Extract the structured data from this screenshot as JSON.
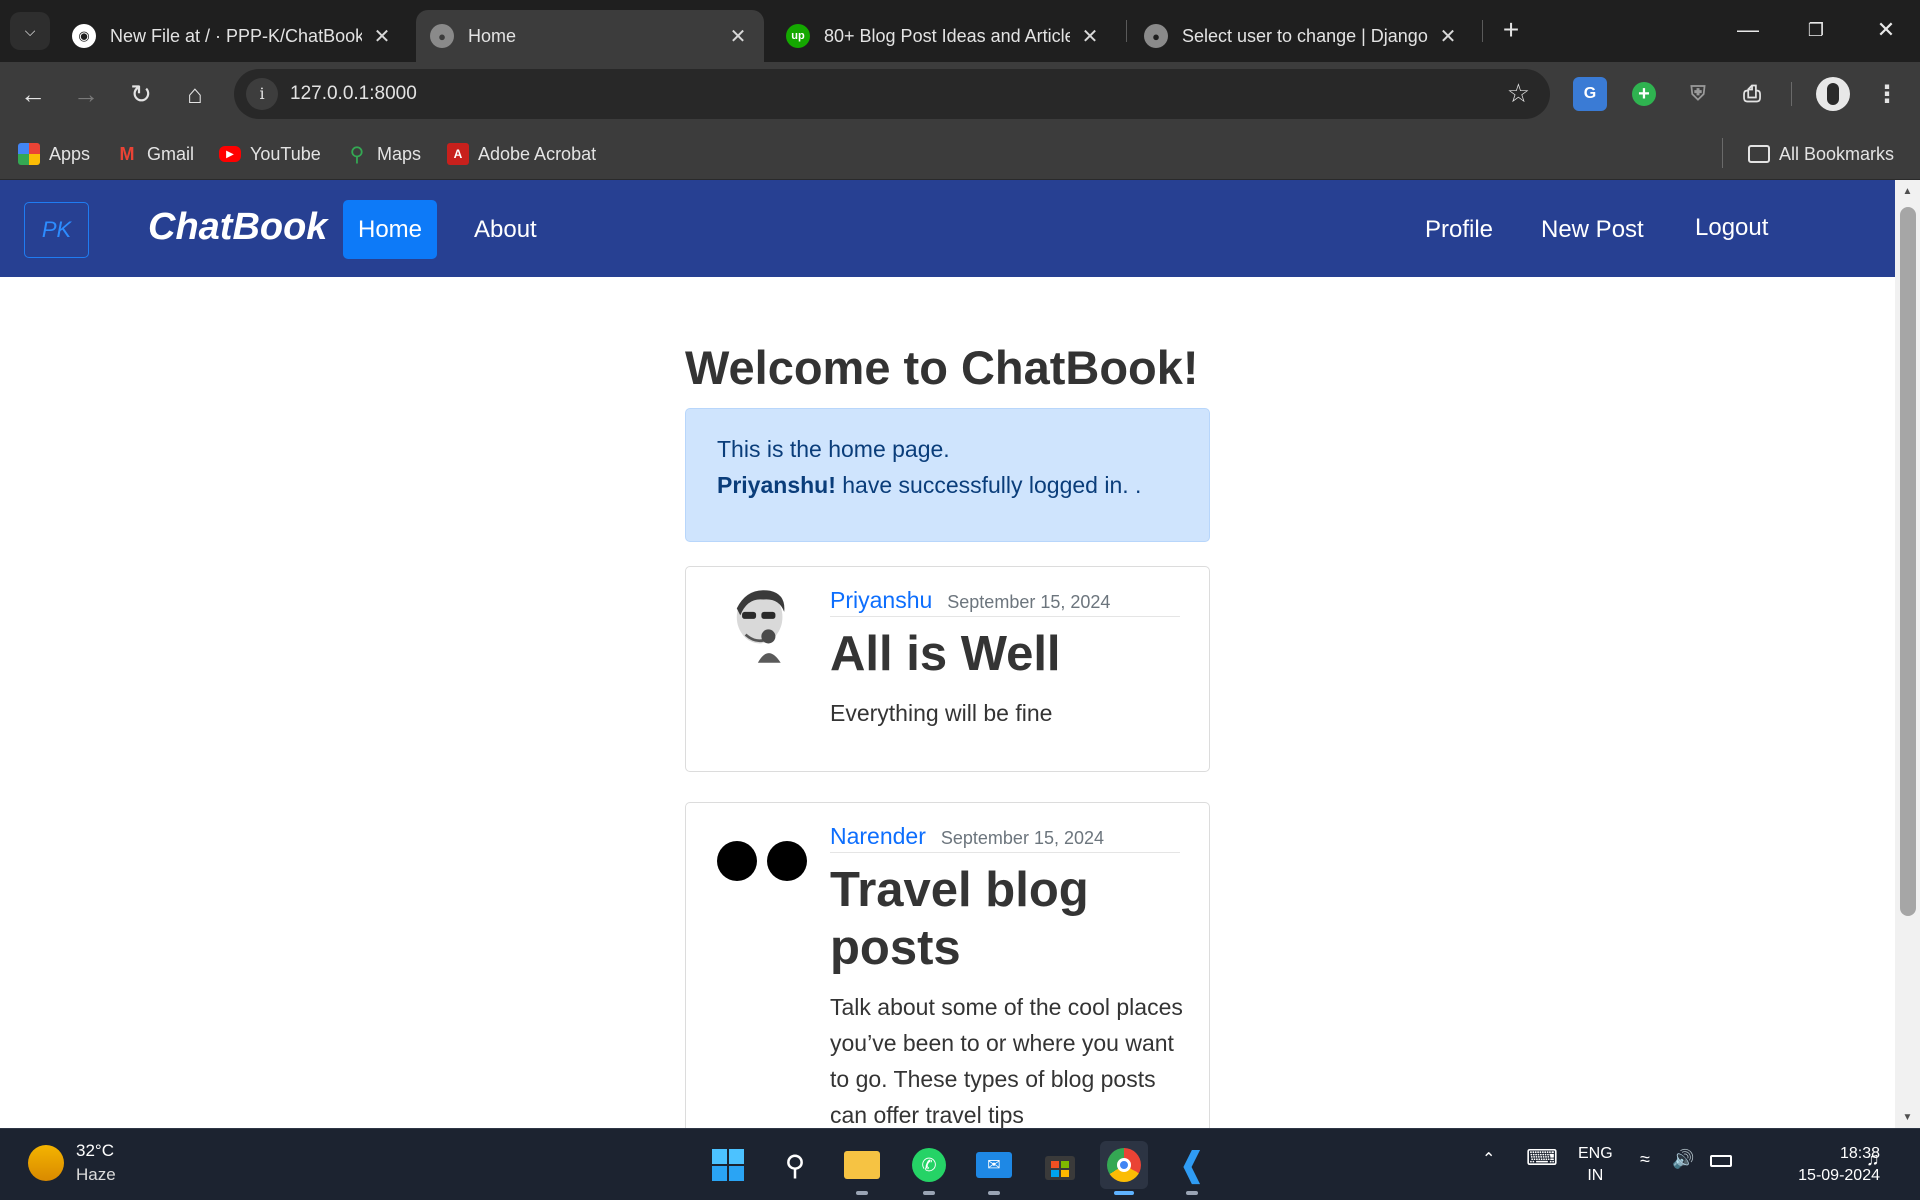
{
  "browser": {
    "tabs": [
      {
        "title": "New File at / · PPP-K/ChatBook",
        "icon": "github-icon",
        "active": false
      },
      {
        "title": "Home",
        "icon": "globe-icon",
        "active": true
      },
      {
        "title": "80+ Blog Post Ideas and Article",
        "icon": "upwork-icon",
        "active": false
      },
      {
        "title": "Select user to change | Django s",
        "icon": "globe-icon",
        "active": false
      }
    ],
    "address": "127.0.0.1:8000",
    "bookmarks": [
      {
        "label": "Apps",
        "icon": "apps-grid-icon"
      },
      {
        "label": "Gmail",
        "icon": "gmail-icon"
      },
      {
        "label": "YouTube",
        "icon": "youtube-icon"
      },
      {
        "label": "Maps",
        "icon": "maps-icon"
      },
      {
        "label": "Adobe Acrobat",
        "icon": "acrobat-icon"
      }
    ],
    "all_bookmarks": "All Bookmarks"
  },
  "site": {
    "logo_text": "PK",
    "brand": "ChatBook",
    "nav_left": [
      "Home",
      "About"
    ],
    "nav_right": [
      "Profile",
      "New Post",
      "Logout"
    ],
    "active_nav": "Home",
    "colors": {
      "navbar": "#274092",
      "active_link": "#0d7af8",
      "alert_bg": "#cfe4fd",
      "author_link": "#0d6efd"
    }
  },
  "page": {
    "welcome": "Welcome to ChatBook!",
    "alert_line1": "This is the home page.",
    "alert_user": "Priyanshu!",
    "alert_rest": "have successfully logged in. ."
  },
  "posts": [
    {
      "author": "Priyanshu",
      "date": "September 15, 2024",
      "title": "All is Well",
      "content": "Everything will be fine"
    },
    {
      "author": "Narender",
      "date": "September 15, 2024",
      "title": "Travel blog posts",
      "content": "Talk about some of the cool places you’ve been to or where you want to go. These types of blog posts can offer travel tips"
    }
  ],
  "taskbar": {
    "weather_temp": "32°C",
    "weather_cond": "Haze",
    "lang_1": "ENG",
    "lang_2": "IN",
    "time": "18:38",
    "date": "15-09-2024"
  }
}
